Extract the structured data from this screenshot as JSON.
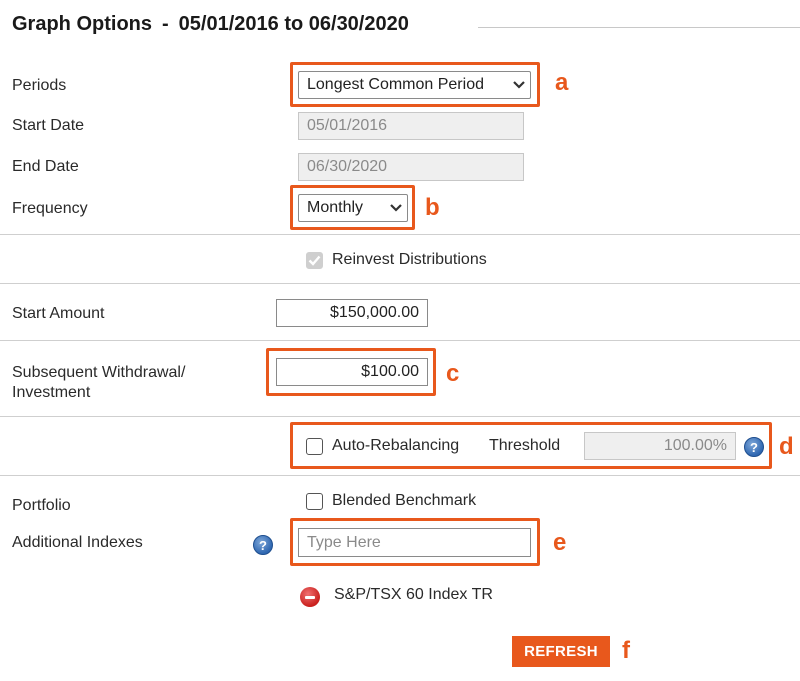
{
  "header": {
    "title": "Graph Options",
    "separator": "-",
    "date_range": "05/01/2016 to 06/30/2020"
  },
  "form": {
    "periods": {
      "label": "Periods",
      "value": "Longest Common Period"
    },
    "start_date": {
      "label": "Start Date",
      "value": "05/01/2016"
    },
    "end_date": {
      "label": "End Date",
      "value": "06/30/2020"
    },
    "frequency": {
      "label": "Frequency",
      "value": "Monthly"
    },
    "reinvest": {
      "label": "Reinvest Distributions",
      "checked": true,
      "disabled": true
    },
    "start_amount": {
      "label": "Start Amount",
      "value": "$150,000.00"
    },
    "subsequent": {
      "label_line1": "Subsequent Withdrawal/",
      "label_line2": "Investment",
      "value": "$100.00"
    },
    "auto_rebalancing": {
      "label": "Auto-Rebalancing",
      "checked": false,
      "threshold_label": "Threshold",
      "threshold_value": "100.00%"
    },
    "portfolio": {
      "label": "Portfolio",
      "blended_label": "Blended Benchmark",
      "checked": false
    },
    "additional_indexes": {
      "label": "Additional Indexes",
      "placeholder": "Type Here"
    },
    "selected_indexes": [
      "S&P/TSX 60 Index TR"
    ]
  },
  "actions": {
    "refresh_label": "REFRESH"
  },
  "callouts": {
    "a": "a",
    "b": "b",
    "c": "c",
    "d": "d",
    "e": "e",
    "f": "f"
  },
  "colors": {
    "accent": "#e8581c",
    "help_blue": "#2f67b1",
    "remove_red": "#c9201d"
  },
  "icons": [
    "chevron-down-icon",
    "help-icon",
    "remove-icon",
    "checkmark-icon"
  ]
}
